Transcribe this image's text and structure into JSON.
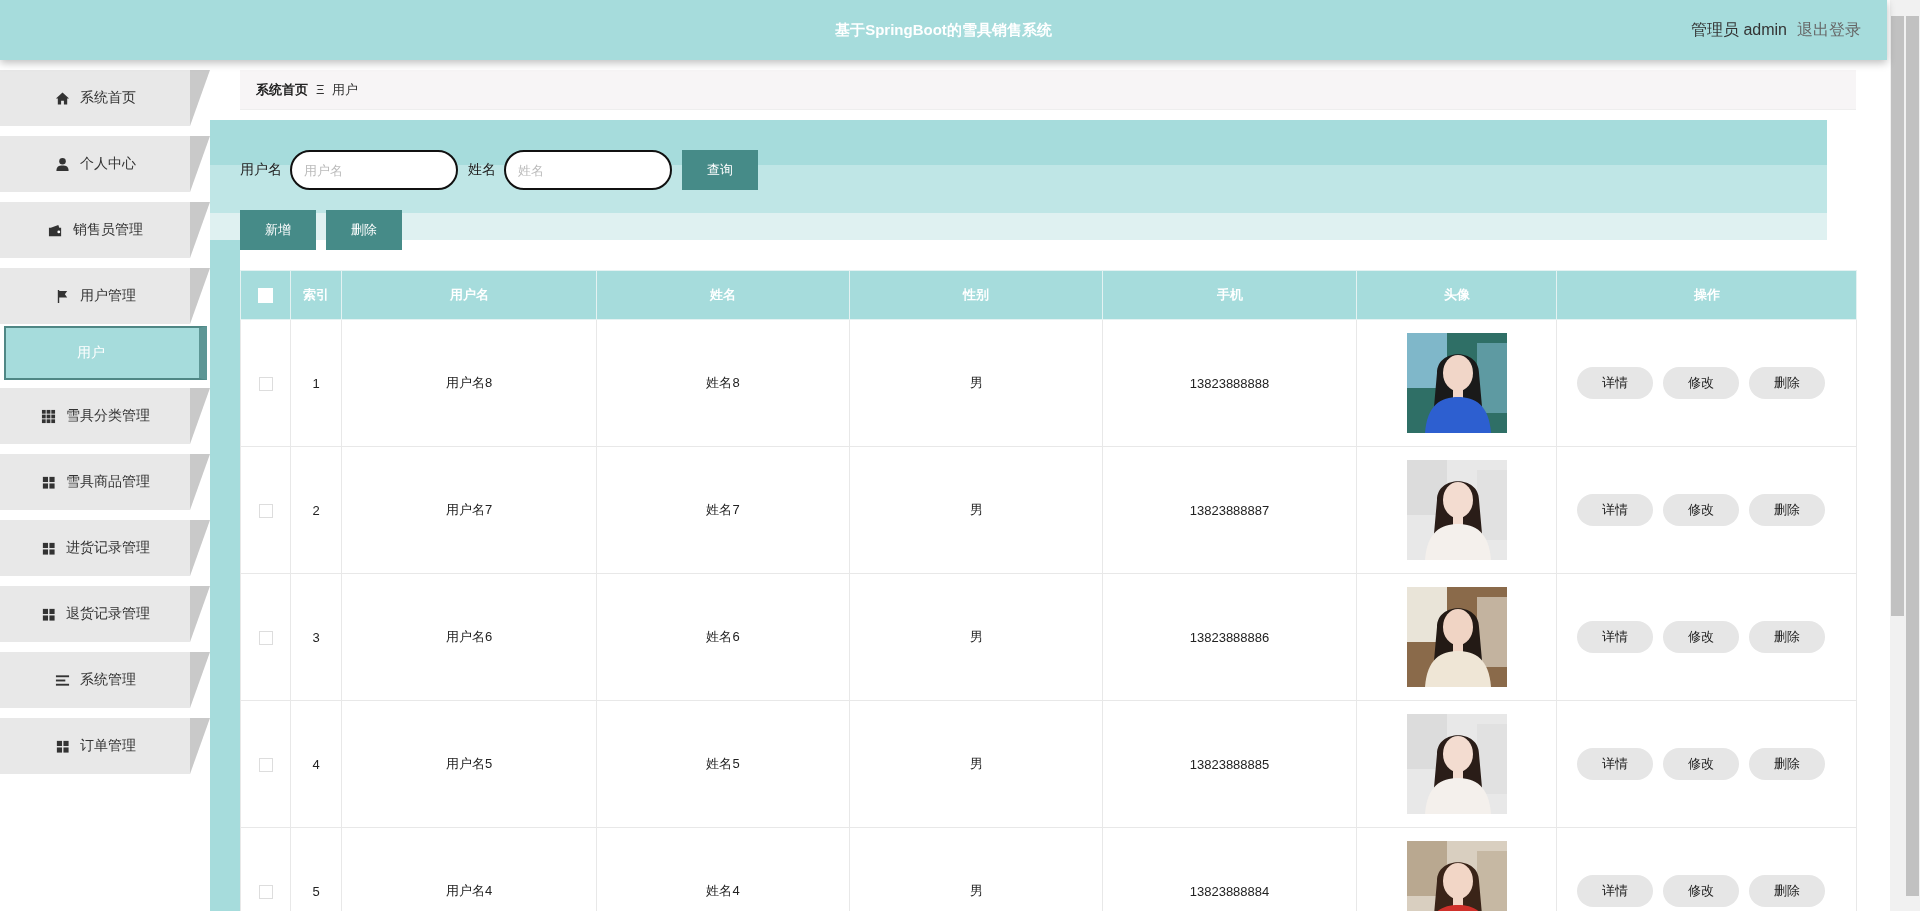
{
  "header": {
    "title": "基于SpringBoot的雪具销售系统",
    "user": "管理员 admin",
    "logout": "退出登录"
  },
  "sidebar": {
    "items": [
      {
        "label": "系统首页",
        "selected": false
      },
      {
        "label": "个人中心",
        "selected": false
      },
      {
        "label": "销售员管理",
        "selected": false
      },
      {
        "label": "用户管理",
        "selected": false,
        "children": [
          {
            "label": "用户",
            "selected": true
          }
        ]
      },
      {
        "label": "雪具分类管理",
        "selected": false
      },
      {
        "label": "雪具商品管理",
        "selected": false
      },
      {
        "label": "进货记录管理",
        "selected": false
      },
      {
        "label": "退货记录管理",
        "selected": false
      },
      {
        "label": "系统管理",
        "selected": false
      },
      {
        "label": "订单管理",
        "selected": false
      }
    ]
  },
  "breadcrumb": {
    "items": [
      "系统首页",
      "用户"
    ],
    "separator": "Ξ"
  },
  "search": {
    "fields": [
      {
        "label": "用户名",
        "placeholder": "用户名"
      },
      {
        "label": "姓名",
        "placeholder": "姓名"
      }
    ],
    "button": "查询"
  },
  "actions": [
    "新增",
    "删除"
  ],
  "table": {
    "select_all_checked": false,
    "columns": [
      "索引",
      "用户名",
      "姓名",
      "性别",
      "手机",
      "头像",
      "操作"
    ],
    "rows": [
      {
        "checked": false,
        "index": "1",
        "username": "用户名8",
        "name": "姓名8",
        "gender": "男",
        "phone": "13823888888",
        "actions": [
          "详情",
          "修改",
          "删除"
        ]
      },
      {
        "checked": false,
        "index": "2",
        "username": "用户名7",
        "name": "姓名7",
        "gender": "男",
        "phone": "13823888887",
        "actions": [
          "详情",
          "修改",
          "删除"
        ]
      },
      {
        "checked": false,
        "index": "3",
        "username": "用户名6",
        "name": "姓名6",
        "gender": "男",
        "phone": "13823888886",
        "actions": [
          "详情",
          "修改",
          "删除"
        ]
      },
      {
        "checked": false,
        "index": "4",
        "username": "用户名5",
        "name": "姓名5",
        "gender": "男",
        "phone": "13823888885",
        "actions": [
          "详情",
          "修改",
          "删除"
        ]
      },
      {
        "checked": false,
        "index": "5",
        "username": "用户名4",
        "name": "姓名4",
        "gender": "男",
        "phone": "13823888884",
        "actions": [
          "详情",
          "修改",
          "删除"
        ]
      }
    ]
  }
}
